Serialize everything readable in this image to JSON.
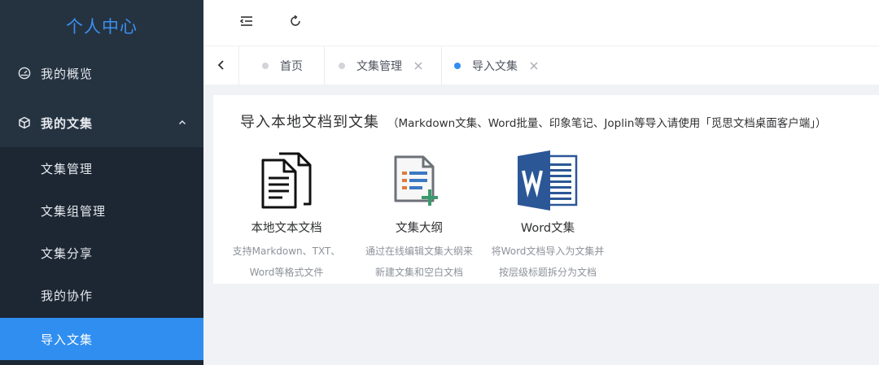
{
  "sidebar": {
    "title": "个人中心",
    "items": [
      {
        "label": "我的概览",
        "icon": "gauge-icon"
      },
      {
        "label": "我的文集",
        "icon": "cube-icon",
        "expanded": true
      }
    ],
    "subitems": [
      {
        "label": "文集管理",
        "active": false
      },
      {
        "label": "文集组管理",
        "active": false
      },
      {
        "label": "文集分享",
        "active": false
      },
      {
        "label": "我的协作",
        "active": false
      },
      {
        "label": "导入文集",
        "active": true
      }
    ]
  },
  "toolbar": {
    "collapse_icon": "collapse-menu-icon",
    "refresh_icon": "refresh-icon"
  },
  "tabs": [
    {
      "label": "首页",
      "active": false,
      "closable": false
    },
    {
      "label": "文集管理",
      "active": false,
      "closable": true
    },
    {
      "label": "导入文集",
      "active": true,
      "closable": true
    }
  ],
  "main": {
    "title": "导入本地文档到文集",
    "note": "（Markdown文集、Word批量、印象笔记、Joplin等导入请使用「觅思文档桌面客户端」）",
    "options": [
      {
        "label": "本地文本文档",
        "icon": "documents-icon",
        "desc1": "支持Markdown、TXT、",
        "desc2": "Word等格式文件"
      },
      {
        "label": "文集大纲",
        "icon": "outline-add-icon",
        "desc1": "通过在线编辑文集大纲来",
        "desc2": "新建文集和空白文档"
      },
      {
        "label": "Word文集",
        "icon": "word-icon",
        "desc1": "将Word文档导入为文集并",
        "desc2": "按层级标题拆分为文档"
      }
    ]
  },
  "colors": {
    "sidebar_bg": "#253341",
    "submenu_bg": "#1c2733",
    "accent": "#2f8ef0",
    "brand": "#3b8ff0",
    "word_blue": "#2b5797"
  }
}
